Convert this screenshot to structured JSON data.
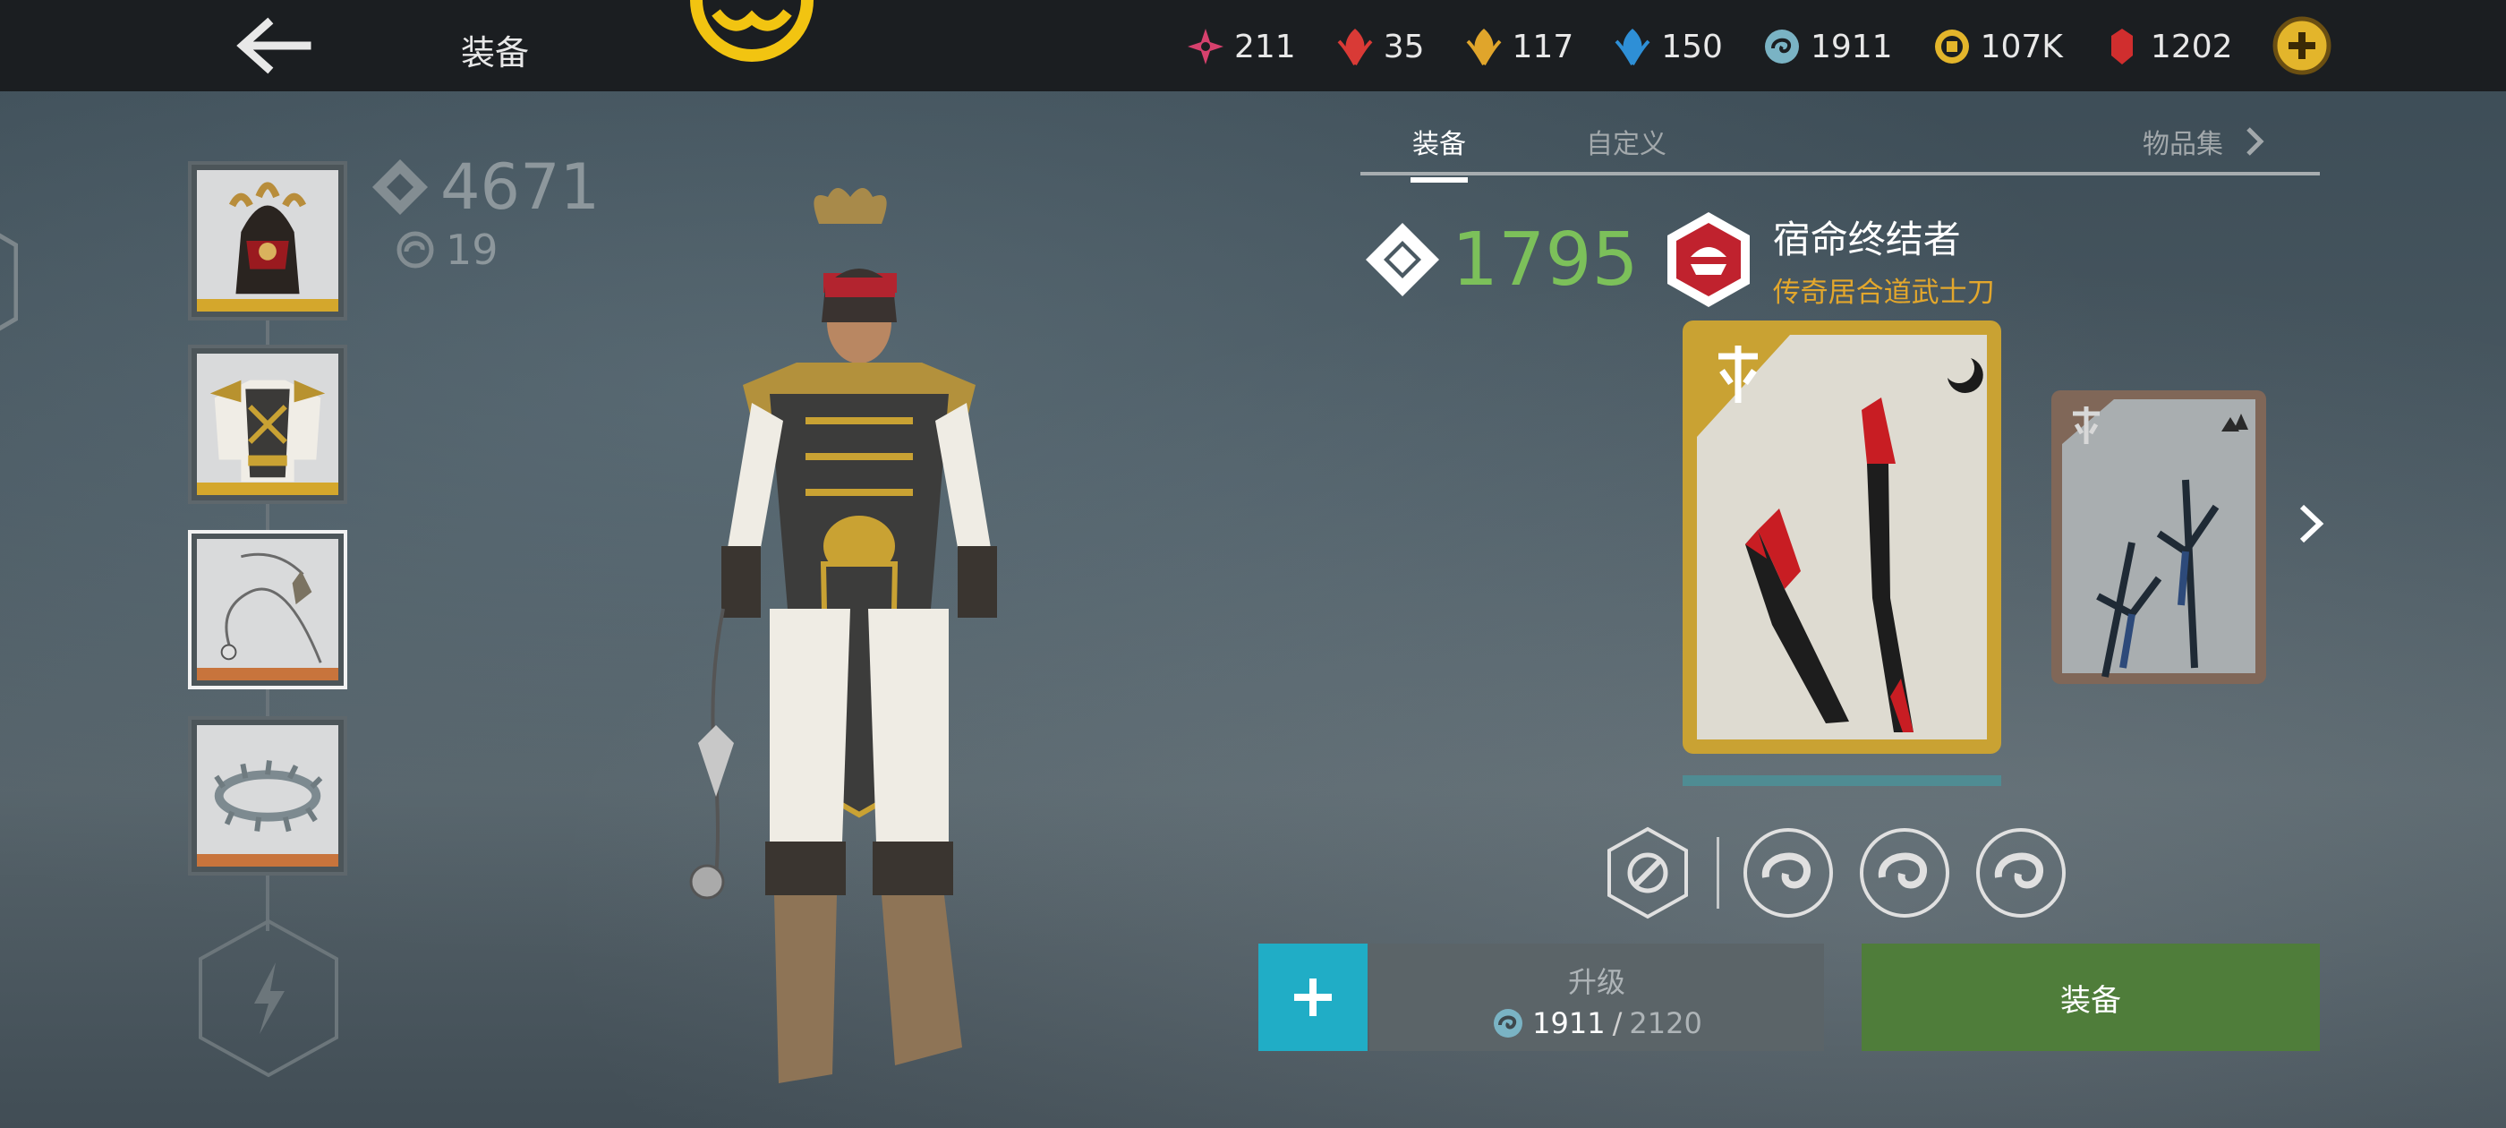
{
  "header": {
    "title": "装备"
  },
  "currencies": [
    {
      "icon": "pink-shard-icon",
      "value": "211",
      "color": "#d6416d"
    },
    {
      "icon": "red-leaf-icon",
      "value": "35",
      "color": "#d93a36"
    },
    {
      "icon": "gold-leaf-icon",
      "value": "117",
      "color": "#e0a52b"
    },
    {
      "icon": "blue-leaf-icon",
      "value": "150",
      "color": "#2e8fd6"
    },
    {
      "icon": "spirit-orb-icon",
      "value": "1911",
      "color": "#7ab3c4"
    },
    {
      "icon": "coin-icon",
      "value": "107K",
      "color": "#e3b52b"
    },
    {
      "icon": "ruby-icon",
      "value": "1202",
      "color": "#d02e2e"
    }
  ],
  "character": {
    "power": "4671",
    "level": "19"
  },
  "slots": [
    {
      "name": "helmet",
      "rarity_color": "#d4a72c"
    },
    {
      "name": "armor",
      "rarity_color": "#d4a72c"
    },
    {
      "name": "ranged-weapon",
      "rarity_color": "#c8743c",
      "selected": true
    },
    {
      "name": "magic",
      "rarity_color": "#c8743c"
    }
  ],
  "tabs": {
    "equipment": "装备",
    "custom": "自定义",
    "collection": "物品集"
  },
  "weapon": {
    "power": "1795",
    "name": "宿命终结者",
    "type": "传奇居合道武士刀"
  },
  "buttons": {
    "upgrade_label": "升级",
    "upgrade_have": "1911",
    "upgrade_sep": "/",
    "upgrade_need": "2120",
    "equip_label": "装备"
  },
  "colors": {
    "accent_teal": "#20adc6",
    "equip_green": "#4f7d3a",
    "power_green": "#7cc05a",
    "legendary_gold": "#c9a233"
  }
}
